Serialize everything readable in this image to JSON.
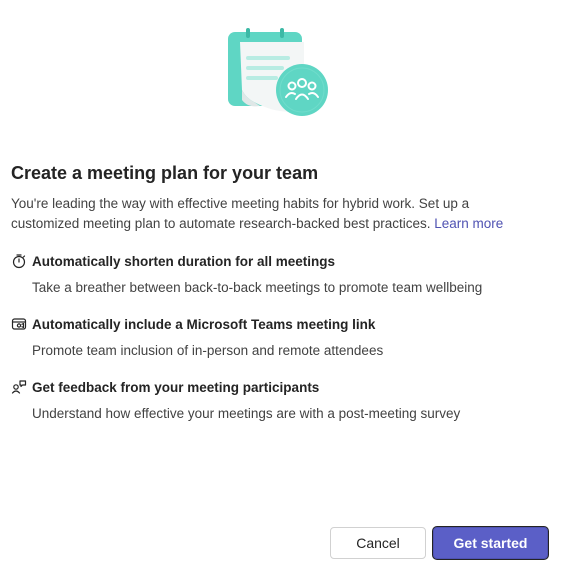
{
  "dialog": {
    "title": "Create a meeting plan for your team",
    "description": "You're leading the way with effective meeting habits for hybrid work. Set up a customized meeting plan to automate research-backed best practices.",
    "learn_more": "Learn more"
  },
  "features": [
    {
      "icon": "timer-icon",
      "title": "Automatically shorten duration for all meetings",
      "subtitle": "Take a breather between back-to-back meetings to promote team wellbeing"
    },
    {
      "icon": "teams-link-icon",
      "title": "Automatically include a Microsoft Teams meeting link",
      "subtitle": "Promote team inclusion of in-person and remote attendees"
    },
    {
      "icon": "people-feedback-icon",
      "title": "Get feedback from your meeting participants",
      "subtitle": "Understand how effective your meetings are with a post-meeting survey"
    }
  ],
  "buttons": {
    "cancel": "Cancel",
    "get_started": "Get started"
  },
  "colors": {
    "accent": "#5b5fc7",
    "illustration_teal": "#5fd6c4",
    "link": "#4f52b2"
  }
}
